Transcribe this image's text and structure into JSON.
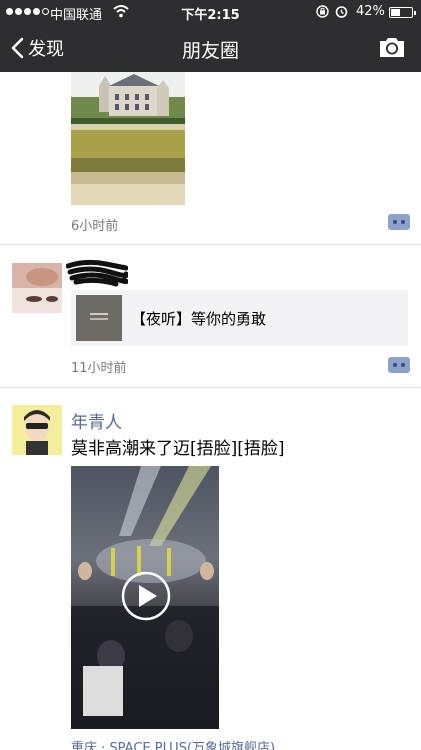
{
  "status_bar": {
    "carrier": "中国联通",
    "time": "下午2:15",
    "battery": "42%"
  },
  "nav": {
    "back_label": "发现",
    "title": "朋友圈"
  },
  "posts": [
    {
      "time": "6小时前"
    },
    {
      "share_title": "【夜听】等你的勇敢",
      "time": "11小时前"
    },
    {
      "name": "年青人",
      "text": "莫非高潮来了迈[捂脸][捂脸]",
      "location": "重庆 · SPACE PLUS(万象城旗舰店)"
    }
  ],
  "colors": {
    "bar": "#2e2d32",
    "link": "#576b95",
    "meta": "#7a7a7a"
  }
}
